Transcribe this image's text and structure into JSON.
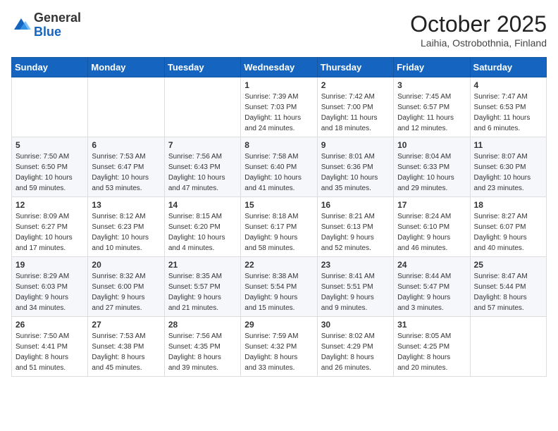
{
  "header": {
    "logo_general": "General",
    "logo_blue": "Blue",
    "month_title": "October 2025",
    "location": "Laihia, Ostrobothnia, Finland"
  },
  "weekdays": [
    "Sunday",
    "Monday",
    "Tuesday",
    "Wednesday",
    "Thursday",
    "Friday",
    "Saturday"
  ],
  "weeks": [
    [
      {
        "day": "",
        "info": ""
      },
      {
        "day": "",
        "info": ""
      },
      {
        "day": "",
        "info": ""
      },
      {
        "day": "1",
        "info": "Sunrise: 7:39 AM\nSunset: 7:03 PM\nDaylight: 11 hours\nand 24 minutes."
      },
      {
        "day": "2",
        "info": "Sunrise: 7:42 AM\nSunset: 7:00 PM\nDaylight: 11 hours\nand 18 minutes."
      },
      {
        "day": "3",
        "info": "Sunrise: 7:45 AM\nSunset: 6:57 PM\nDaylight: 11 hours\nand 12 minutes."
      },
      {
        "day": "4",
        "info": "Sunrise: 7:47 AM\nSunset: 6:53 PM\nDaylight: 11 hours\nand 6 minutes."
      }
    ],
    [
      {
        "day": "5",
        "info": "Sunrise: 7:50 AM\nSunset: 6:50 PM\nDaylight: 10 hours\nand 59 minutes."
      },
      {
        "day": "6",
        "info": "Sunrise: 7:53 AM\nSunset: 6:47 PM\nDaylight: 10 hours\nand 53 minutes."
      },
      {
        "day": "7",
        "info": "Sunrise: 7:56 AM\nSunset: 6:43 PM\nDaylight: 10 hours\nand 47 minutes."
      },
      {
        "day": "8",
        "info": "Sunrise: 7:58 AM\nSunset: 6:40 PM\nDaylight: 10 hours\nand 41 minutes."
      },
      {
        "day": "9",
        "info": "Sunrise: 8:01 AM\nSunset: 6:36 PM\nDaylight: 10 hours\nand 35 minutes."
      },
      {
        "day": "10",
        "info": "Sunrise: 8:04 AM\nSunset: 6:33 PM\nDaylight: 10 hours\nand 29 minutes."
      },
      {
        "day": "11",
        "info": "Sunrise: 8:07 AM\nSunset: 6:30 PM\nDaylight: 10 hours\nand 23 minutes."
      }
    ],
    [
      {
        "day": "12",
        "info": "Sunrise: 8:09 AM\nSunset: 6:27 PM\nDaylight: 10 hours\nand 17 minutes."
      },
      {
        "day": "13",
        "info": "Sunrise: 8:12 AM\nSunset: 6:23 PM\nDaylight: 10 hours\nand 10 minutes."
      },
      {
        "day": "14",
        "info": "Sunrise: 8:15 AM\nSunset: 6:20 PM\nDaylight: 10 hours\nand 4 minutes."
      },
      {
        "day": "15",
        "info": "Sunrise: 8:18 AM\nSunset: 6:17 PM\nDaylight: 9 hours\nand 58 minutes."
      },
      {
        "day": "16",
        "info": "Sunrise: 8:21 AM\nSunset: 6:13 PM\nDaylight: 9 hours\nand 52 minutes."
      },
      {
        "day": "17",
        "info": "Sunrise: 8:24 AM\nSunset: 6:10 PM\nDaylight: 9 hours\nand 46 minutes."
      },
      {
        "day": "18",
        "info": "Sunrise: 8:27 AM\nSunset: 6:07 PM\nDaylight: 9 hours\nand 40 minutes."
      }
    ],
    [
      {
        "day": "19",
        "info": "Sunrise: 8:29 AM\nSunset: 6:03 PM\nDaylight: 9 hours\nand 34 minutes."
      },
      {
        "day": "20",
        "info": "Sunrise: 8:32 AM\nSunset: 6:00 PM\nDaylight: 9 hours\nand 27 minutes."
      },
      {
        "day": "21",
        "info": "Sunrise: 8:35 AM\nSunset: 5:57 PM\nDaylight: 9 hours\nand 21 minutes."
      },
      {
        "day": "22",
        "info": "Sunrise: 8:38 AM\nSunset: 5:54 PM\nDaylight: 9 hours\nand 15 minutes."
      },
      {
        "day": "23",
        "info": "Sunrise: 8:41 AM\nSunset: 5:51 PM\nDaylight: 9 hours\nand 9 minutes."
      },
      {
        "day": "24",
        "info": "Sunrise: 8:44 AM\nSunset: 5:47 PM\nDaylight: 9 hours\nand 3 minutes."
      },
      {
        "day": "25",
        "info": "Sunrise: 8:47 AM\nSunset: 5:44 PM\nDaylight: 8 hours\nand 57 minutes."
      }
    ],
    [
      {
        "day": "26",
        "info": "Sunrise: 7:50 AM\nSunset: 4:41 PM\nDaylight: 8 hours\nand 51 minutes."
      },
      {
        "day": "27",
        "info": "Sunrise: 7:53 AM\nSunset: 4:38 PM\nDaylight: 8 hours\nand 45 minutes."
      },
      {
        "day": "28",
        "info": "Sunrise: 7:56 AM\nSunset: 4:35 PM\nDaylight: 8 hours\nand 39 minutes."
      },
      {
        "day": "29",
        "info": "Sunrise: 7:59 AM\nSunset: 4:32 PM\nDaylight: 8 hours\nand 33 minutes."
      },
      {
        "day": "30",
        "info": "Sunrise: 8:02 AM\nSunset: 4:29 PM\nDaylight: 8 hours\nand 26 minutes."
      },
      {
        "day": "31",
        "info": "Sunrise: 8:05 AM\nSunset: 4:25 PM\nDaylight: 8 hours\nand 20 minutes."
      },
      {
        "day": "",
        "info": ""
      }
    ]
  ]
}
